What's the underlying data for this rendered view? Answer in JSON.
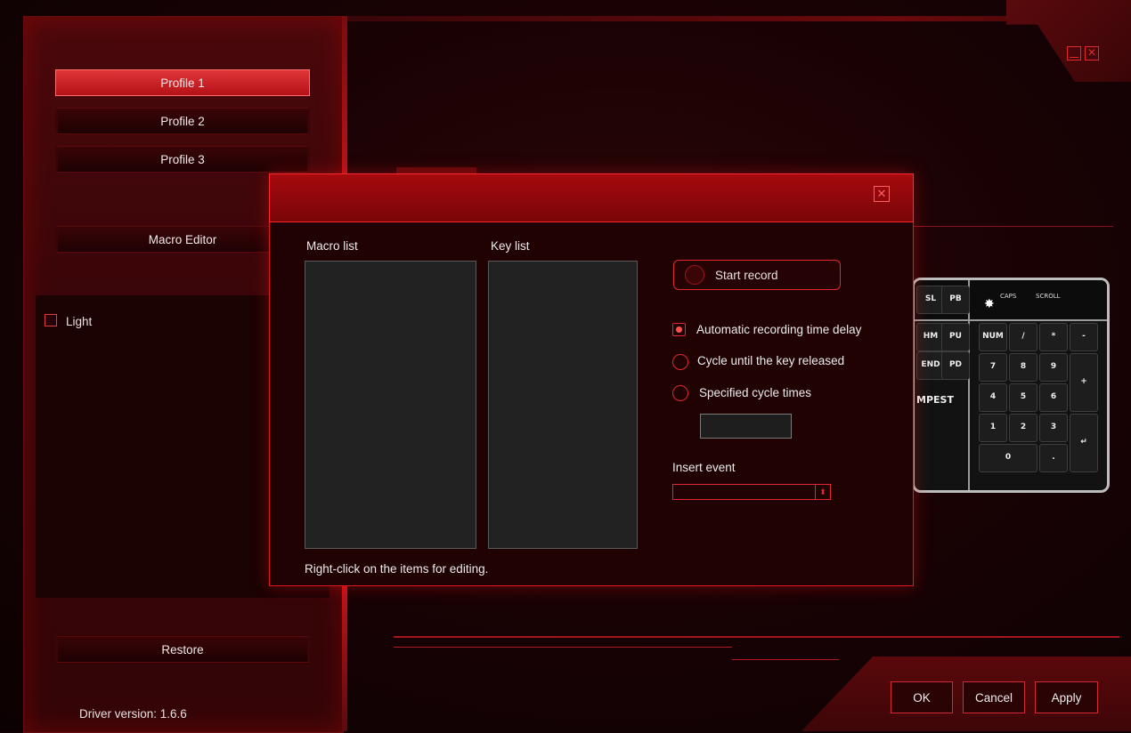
{
  "sidebar": {
    "profiles": [
      {
        "label": "Profile 1",
        "active": true
      },
      {
        "label": "Profile 2",
        "active": false
      },
      {
        "label": "Profile 3",
        "active": false
      }
    ],
    "macro_editor_label": "Macro Editor",
    "light_label": "Light",
    "restore_label": "Restore",
    "driver_version": "Driver version:  1.6.6"
  },
  "window": {
    "minimize_icon": "minimize-icon",
    "close_icon": "close-icon"
  },
  "dialog": {
    "macro_list_label": "Macro list",
    "key_list_label": "Key list",
    "start_record_label": "Start record",
    "options": [
      {
        "label": "Automatic recording time delay",
        "selected": true
      },
      {
        "label": "Cycle until the key released",
        "selected": false
      },
      {
        "label": "Specified cycle times",
        "selected": false
      }
    ],
    "cycle_times_value": "",
    "insert_event_label": "Insert event",
    "insert_event_value": "",
    "hint": "Right-click on the items for editing."
  },
  "keyboard": {
    "top_labels": [
      "CAPS",
      "SCROLL"
    ],
    "nav_keys": [
      "SL",
      "PB",
      "HM",
      "PU",
      "END",
      "PD"
    ],
    "brand": "MPEST",
    "numpad": [
      "NUM",
      "/",
      "*",
      "-",
      "7",
      "8",
      "9",
      "+",
      "4",
      "5",
      "6",
      "1",
      "2",
      "3",
      "0",
      "."
    ]
  },
  "footer": {
    "ok_label": "OK",
    "cancel_label": "Cancel",
    "apply_label": "Apply"
  },
  "colors": {
    "accent": "#e2282e",
    "background": "#1b0203",
    "active_button": "#c8191e"
  }
}
